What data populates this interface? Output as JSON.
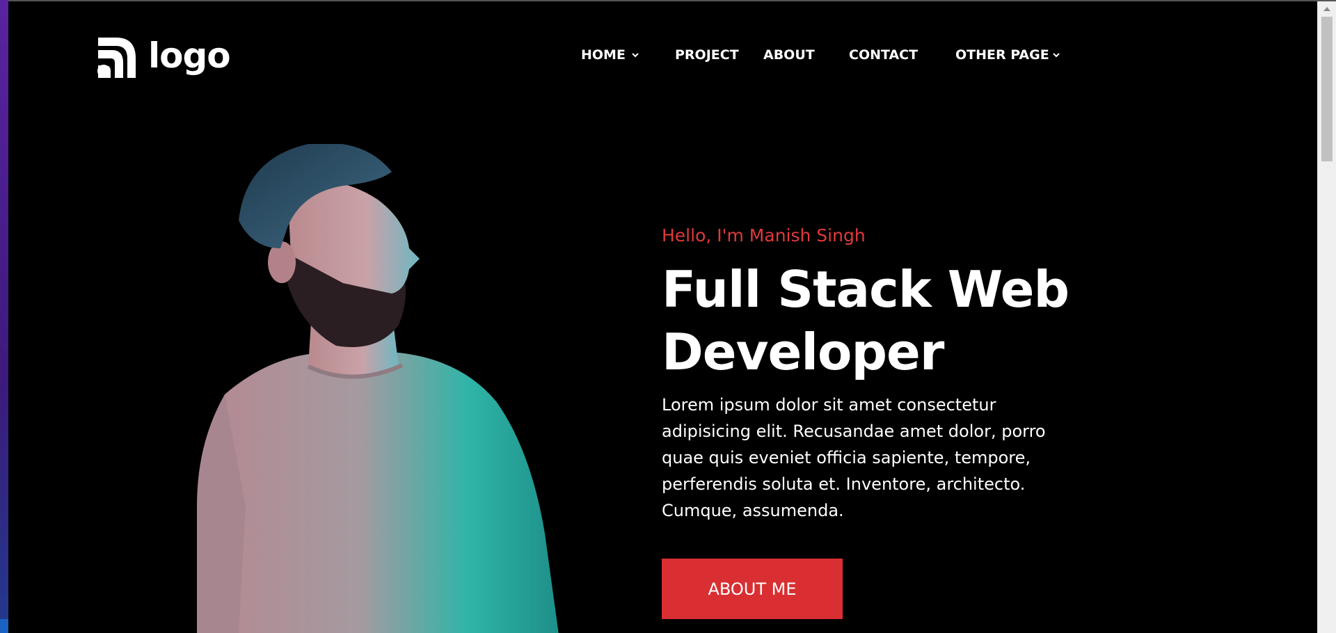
{
  "brand": {
    "logo_text": "logo",
    "accent_color": "#d92f32",
    "logo_icon": "rss-arcs-icon"
  },
  "nav": {
    "home": "HOME",
    "project": "PROJECT",
    "about": "ABOUT",
    "contact": "CONTACT",
    "other_page": "OTHER PAGE"
  },
  "hero": {
    "greeting": "Hello, I'm Manish Singh",
    "title_line1": "Full Stack Web",
    "title_line2": "Developer",
    "body": "Lorem ipsum dolor sit amet consectetur adipisicing elit. Recusandae amet dolor, porro quae quis eveniet officia sapiente, tempore, perferendis soluta et. Inventore, architecto. Cumque, assumenda.",
    "button_label": "ABOUT ME",
    "image": "portrait-of-bearded-man-in-neon-light"
  }
}
